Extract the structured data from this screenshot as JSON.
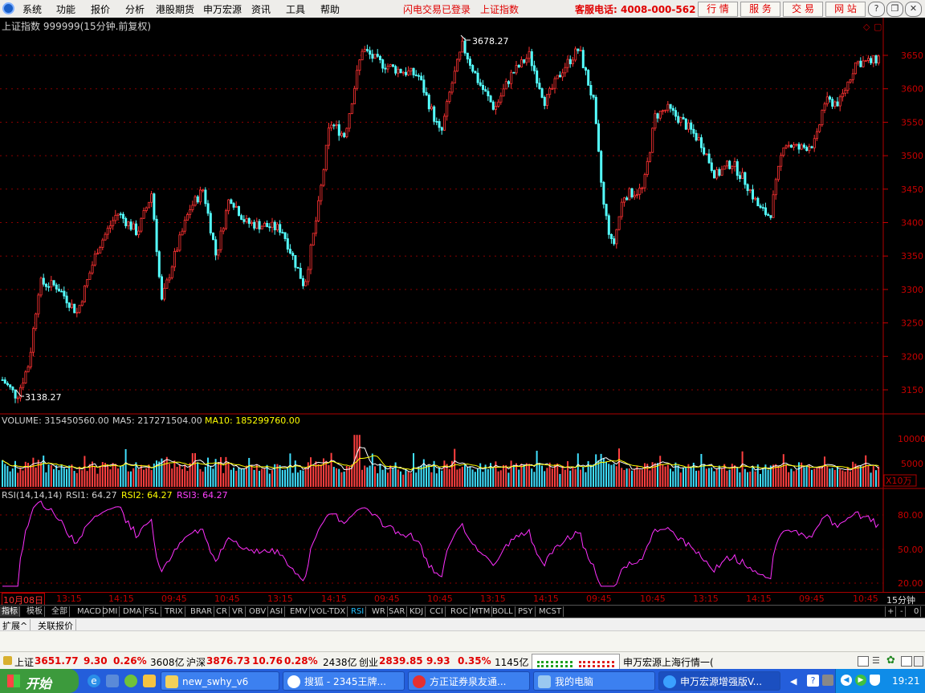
{
  "menu": {
    "items": [
      "系统",
      "功能",
      "报价",
      "分析",
      "港股期货",
      "申万宏源",
      "资讯",
      "工具",
      "帮助"
    ],
    "notice1": "闪电交易已登录",
    "notice2": "上证指数",
    "service_phone": "客服电话: 4008-000-562",
    "buttons": [
      "行 情",
      "服 务",
      "交 易",
      "网 站"
    ]
  },
  "chart_header": {
    "title": "上证指数 999999(15分钟.前复权)"
  },
  "price_panel": {
    "high_label": "3678.27",
    "low_label": "3138.27",
    "y_ticks": [
      "3650",
      "3600",
      "3550",
      "3500",
      "3450",
      "3400",
      "3350",
      "3300",
      "3250",
      "3200",
      "3150"
    ],
    "colors": {
      "up": "#ff3232",
      "down": "#54ffff",
      "grid": "#8b0000",
      "axis": "#c80000"
    }
  },
  "volume_panel": {
    "label": "VOLUME: 315450560.00",
    "ma5": "MA5: 217271504.00",
    "ma10": "MA10: 185299760.00",
    "y_ticks": [
      "10000",
      "5000"
    ],
    "unit": "X10万"
  },
  "rsi_panel": {
    "label": "RSI(14,14,14)",
    "rsi1": "RSI1: 64.27",
    "rsi2": "RSI2: 64.27",
    "rsi3": "RSI3: 64.27",
    "y_ticks": [
      "80.00",
      "50.00",
      "20.00"
    ]
  },
  "date_axis": {
    "start_date": "10月08日",
    "labels": [
      "13:15",
      "14:15",
      "09:45",
      "10:45",
      "13:15",
      "14:15",
      "09:45",
      "10:45",
      "13:15",
      "14:15",
      "09:45",
      "10:45",
      "13:15",
      "14:15",
      "09:45",
      "10:45"
    ],
    "period": "15分钟"
  },
  "indicator_tabs": {
    "items": [
      "指标",
      "模板",
      "全部",
      "MACD",
      "DMI",
      "DMA",
      "FSL",
      "TRIX",
      "BRAR",
      "CR",
      "VR",
      "OBV",
      "ASI",
      "EMV",
      "VOL-TDX",
      "RSI",
      "WR",
      "SAR",
      "KDJ",
      "CCI",
      "ROC",
      "MTM",
      "BOLL",
      "PSY",
      "MCST"
    ],
    "active": "RSI",
    "right_controls": [
      "+",
      "-",
      "0"
    ]
  },
  "ext_bar": {
    "items": [
      "扩展^",
      "关联报价"
    ]
  },
  "status_bar": {
    "sh_label": "上证",
    "sh_value": "3651.77",
    "sh_change": "9.30",
    "sh_pct": "0.26%",
    "sh_amount": "3608亿",
    "hs_label": "沪深",
    "hs_value": "3876.73",
    "hs_change": "10.76",
    "hs_pct": "0.28%",
    "hs_amount": "2438亿",
    "cy_label": "创业",
    "cy_value": "2839.85",
    "cy_change": "9.93",
    "cy_pct": "0.35%",
    "cy_amount": "1145亿",
    "ticker": "申万宏源上海行情一("
  },
  "taskbar": {
    "start": "开始",
    "tasks": [
      "new_swhy_v6",
      "搜狐 - 2345王牌...",
      "方正证券泉友通...",
      "我的电脑",
      "申万宏源增强版V..."
    ],
    "clock": "19:21"
  }
}
